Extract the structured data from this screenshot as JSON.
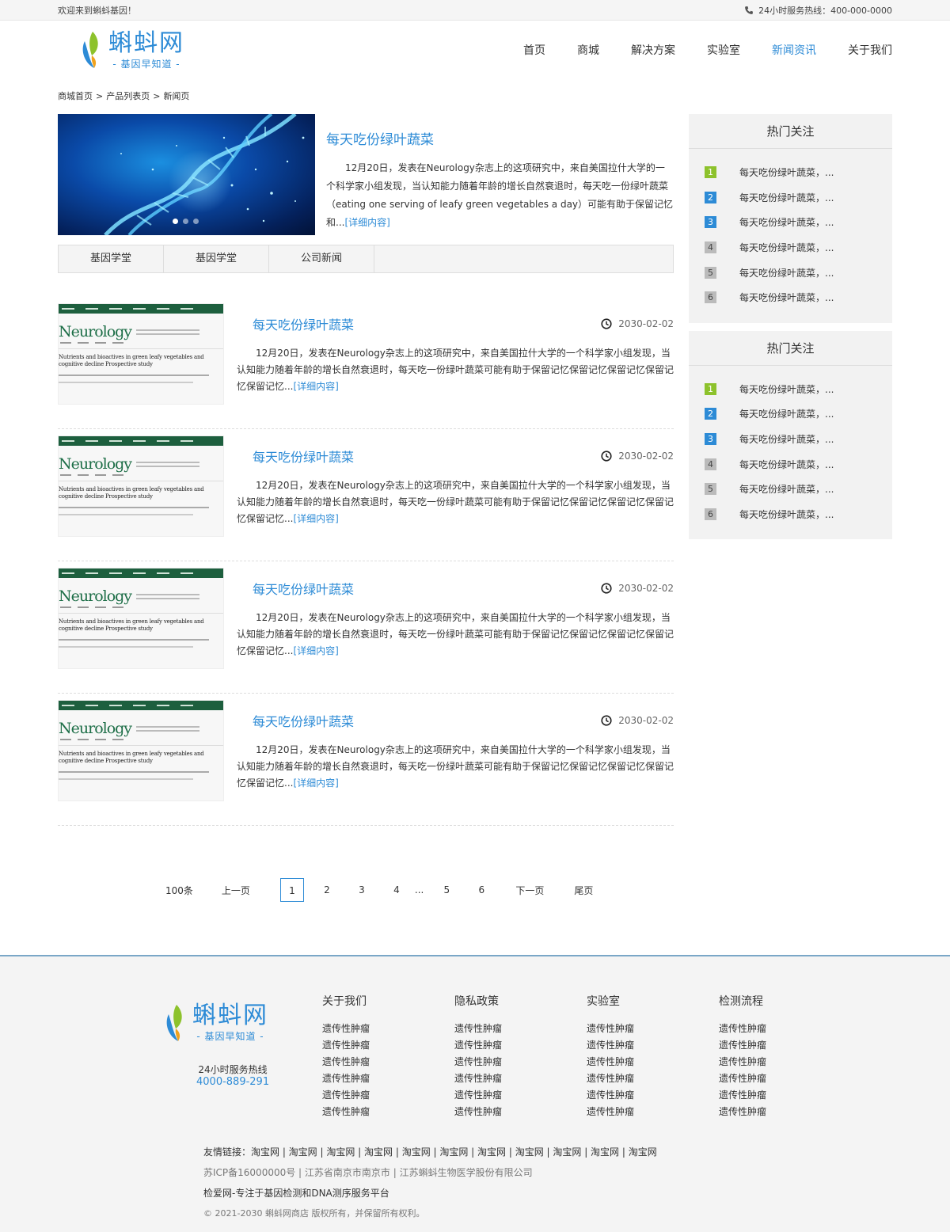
{
  "topbar": {
    "welcome": "欢迎来到蝌蚪基因！",
    "hotline": "24小时服务热线：400-000-0000"
  },
  "logo": {
    "name": "蝌蚪网",
    "slogan": "- 基因早知道 -"
  },
  "nav": [
    {
      "label": "首页"
    },
    {
      "label": "商城"
    },
    {
      "label": "解决方案"
    },
    {
      "label": "实验室"
    },
    {
      "label": "新闻资讯",
      "active": true
    },
    {
      "label": "关于我们"
    }
  ],
  "breadcrumb": [
    "商城首页",
    "产品列表页",
    "新闻页"
  ],
  "breadcrumb_sep": ">",
  "feature": {
    "title": "每天吃份绿叶蔬菜",
    "text": "12月20日，发表在Neurology杂志上的这项研究中，来自美国拉什大学的一个科学家小组发现，当认知能力随着年龄的增长自然衰退时，每天吃一份绿叶蔬菜（eating one serving of leafy green vegetables a day）可能有助于保留记忆和...",
    "more": "[详细内容]"
  },
  "tabs": [
    "基因学堂",
    "基因学堂",
    "公司新闻"
  ],
  "thumb": {
    "journal": "Neurology",
    "headline": "Nutrients and bioactives in green leafy vegetables and cognitive decline Prospective study"
  },
  "articles": [
    {
      "title": "每天吃份绿叶蔬菜",
      "date": "2030-02-02",
      "text": "12月20日，发表在Neurology杂志上的这项研究中，来自美国拉什大学的一个科学家小组发现，当认知能力随着年龄的增长自然衰退时，每天吃一份绿叶蔬菜可能有助于保留记忆保留记忆保留记忆保留记忆保留记忆...",
      "more": "[详细内容]"
    },
    {
      "title": "每天吃份绿叶蔬菜",
      "date": "2030-02-02",
      "text": "12月20日，发表在Neurology杂志上的这项研究中，来自美国拉什大学的一个科学家小组发现，当认知能力随着年龄的增长自然衰退时，每天吃一份绿叶蔬菜可能有助于保留记忆保留记忆保留记忆保留记忆保留记忆...",
      "more": "[详细内容]"
    },
    {
      "title": "每天吃份绿叶蔬菜",
      "date": "2030-02-02",
      "text": "12月20日，发表在Neurology杂志上的这项研究中，来自美国拉什大学的一个科学家小组发现，当认知能力随着年龄的增长自然衰退时，每天吃一份绿叶蔬菜可能有助于保留记忆保留记忆保留记忆保留记忆保留记忆...",
      "more": "[详细内容]"
    },
    {
      "title": "每天吃份绿叶蔬菜",
      "date": "2030-02-02",
      "text": "12月20日，发表在Neurology杂志上的这项研究中，来自美国拉什大学的一个科学家小组发现，当认知能力随着年龄的增长自然衰退时，每天吃一份绿叶蔬菜可能有助于保留记忆保留记忆保留记忆保留记忆保留记忆...",
      "more": "[详细内容]"
    }
  ],
  "pager": {
    "total": "100条",
    "prev": "上一页",
    "pages": [
      "1",
      "2",
      "3",
      "4"
    ],
    "ellipsis": "...",
    "pages_after": [
      "5",
      "6"
    ],
    "next": "下一页",
    "last": "尾页",
    "current": "1"
  },
  "sidebar": [
    {
      "title": "热门关注",
      "items": [
        {
          "num": "1",
          "text": "每天吃份绿叶蔬菜，..."
        },
        {
          "num": "2",
          "text": "每天吃份绿叶蔬菜，..."
        },
        {
          "num": "3",
          "text": "每天吃份绿叶蔬菜，..."
        },
        {
          "num": "4",
          "text": "每天吃份绿叶蔬菜，..."
        },
        {
          "num": "5",
          "text": "每天吃份绿叶蔬菜，..."
        },
        {
          "num": "6",
          "text": "每天吃份绿叶蔬菜，..."
        }
      ]
    },
    {
      "title": "热门关注",
      "items": [
        {
          "num": "1",
          "text": "每天吃份绿叶蔬菜，..."
        },
        {
          "num": "2",
          "text": "每天吃份绿叶蔬菜，..."
        },
        {
          "num": "3",
          "text": "每天吃份绿叶蔬菜，..."
        },
        {
          "num": "4",
          "text": "每天吃份绿叶蔬菜，..."
        },
        {
          "num": "5",
          "text": "每天吃份绿叶蔬菜，..."
        },
        {
          "num": "6",
          "text": "每天吃份绿叶蔬菜，..."
        }
      ]
    }
  ],
  "footer": {
    "hotline_label": "24小时服务热线",
    "hotline_number": "4000-889-291",
    "columns": [
      {
        "title": "关于我们",
        "links": [
          "遗传性肿瘤",
          "遗传性肿瘤",
          "遗传性肿瘤",
          "遗传性肿瘤",
          "遗传性肿瘤",
          "遗传性肿瘤"
        ]
      },
      {
        "title": "隐私政策",
        "links": [
          "遗传性肿瘤",
          "遗传性肿瘤",
          "遗传性肿瘤",
          "遗传性肿瘤",
          "遗传性肿瘤",
          "遗传性肿瘤"
        ]
      },
      {
        "title": "实验室",
        "links": [
          "遗传性肿瘤",
          "遗传性肿瘤",
          "遗传性肿瘤",
          "遗传性肿瘤",
          "遗传性肿瘤",
          "遗传性肿瘤"
        ]
      },
      {
        "title": "检测流程",
        "links": [
          "遗传性肿瘤",
          "遗传性肿瘤",
          "遗传性肿瘤",
          "遗传性肿瘤",
          "遗传性肿瘤",
          "遗传性肿瘤"
        ]
      }
    ],
    "friends": "友情链接：淘宝网 | 淘宝网 | 淘宝网 | 淘宝网 | 淘宝网 | 淘宝网 | 淘宝网 | 淘宝网 | 淘宝网 | 淘宝网 | 淘宝网",
    "icp": "苏ICP备16000000号 | 江苏省南京市南京市 | 江苏蝌蚪生物医学股份有限公司",
    "slogan": "检爱网-专注于基因检测和DNA测序服务平台",
    "copyright": "© 2021-2030 蝌蚪网商店 版权所有，并保留所有权利。"
  },
  "colors": {
    "accent": "#2d8bd6",
    "green": "#8dc22c",
    "gray": "#bbbbbb"
  },
  "icons": {
    "phone": "phone-icon",
    "clock": "clock-icon"
  }
}
